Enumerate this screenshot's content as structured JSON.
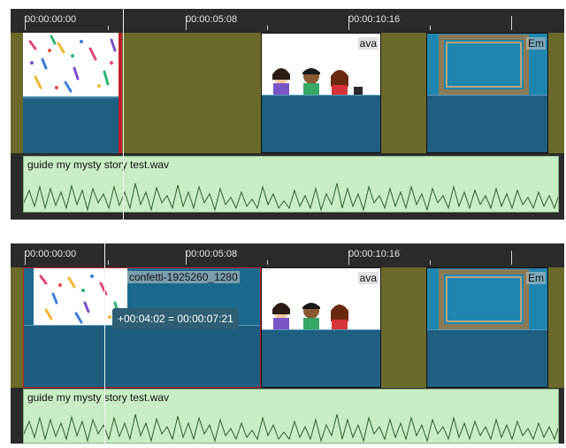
{
  "timeline": {
    "ruler_labels": [
      "00:00:00:00",
      "00:00:05:08",
      "00:00:10:16"
    ],
    "clips": {
      "confetti": "confetti-1925260_1280",
      "avatar": "ava",
      "frame": "Em"
    },
    "audio": {
      "filename": "guide my mysty story  test.wav"
    },
    "tooltip": "+00:04:02 = 00:00:07:21"
  },
  "colors": {
    "background": "#2a2a2a",
    "video_track": "#6c6a2a",
    "clip_blue": "#1b6a8e",
    "audio_green": "#c8ecc4",
    "selection_red": "#c0202a"
  }
}
